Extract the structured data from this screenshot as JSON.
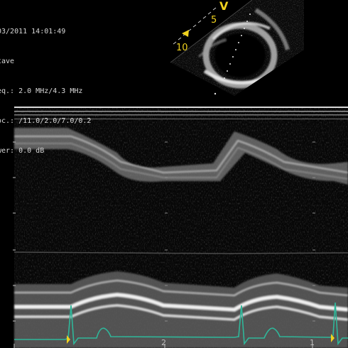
{
  "header": {
    "lines": [
      "03/2011 14:01:49",
      "tave",
      "eq.: 2.0 MHz/4.3 MHz",
      "oc.: /11.0/2.0/7.0/0.2",
      "wer: 0.0 dB"
    ]
  },
  "sector": {
    "orientation_marker": "V",
    "depth_labels": [
      "5",
      "10"
    ]
  },
  "mmode": {
    "time_labels": [
      "2",
      "1"
    ]
  },
  "colors": {
    "background": "#000000",
    "overlay_text": "#d8d8d8",
    "annotation_yellow": "#f0d21e",
    "ecg_trace": "#2fb79a",
    "depth_scale": "#bdbdbd"
  },
  "icons": {
    "orientation_marker": "v-orientation-marker",
    "focus_marker": "yellow-triangle-focus-icon",
    "cursor_markers": "yellow-triangle-cursor-icon"
  }
}
